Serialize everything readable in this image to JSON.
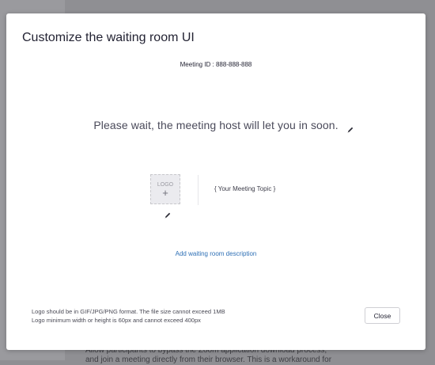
{
  "background": {
    "text": "Allow participants to bypass the Zoom application download process, and join a meeting directly from their browser. This is a workaround for"
  },
  "modal": {
    "title": "Customize the waiting room UI",
    "meeting_id": "Meeting ID : 888-888-888",
    "wait_message": "Please wait, the meeting host will let you in soon.",
    "logo": {
      "label": "LOGO",
      "plus": "+"
    },
    "topic": "{ Your Meeting Topic }",
    "add_description": "Add waiting room description",
    "footnote_line1": "Logo should be in GIF/JPG/PNG format. The file size cannot exceed 1MB",
    "footnote_line2": "Logo minimum width or height is 60px and cannot exceed 400px",
    "close_label": "Close"
  },
  "icons": {
    "wait_edit": "pencil-icon",
    "logo_edit": "pencil-icon"
  }
}
